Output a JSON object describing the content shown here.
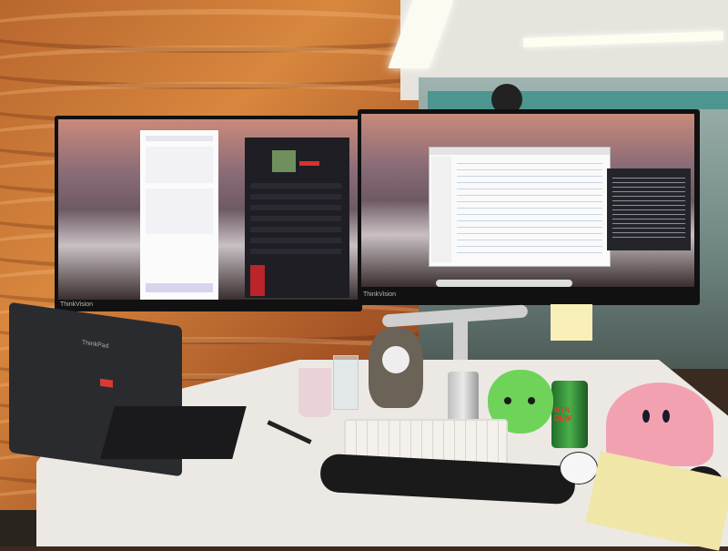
{
  "scene": {
    "monitor_left_brand": "ThinkVision",
    "monitor_right_brand": "ThinkVision",
    "laptop_brand": "ThinkPad",
    "can_label": "MTN DEW"
  },
  "colors": {
    "wall": "#c7753a",
    "desk": "#ece9e4",
    "kirby_pink": "#f2a1b1",
    "plush_green": "#6fd35a",
    "dark_ui": "#1e1e24",
    "accent_red": "#d6322f"
  },
  "icons": [
    "camera-icon",
    "cat-sticker-icon"
  ]
}
